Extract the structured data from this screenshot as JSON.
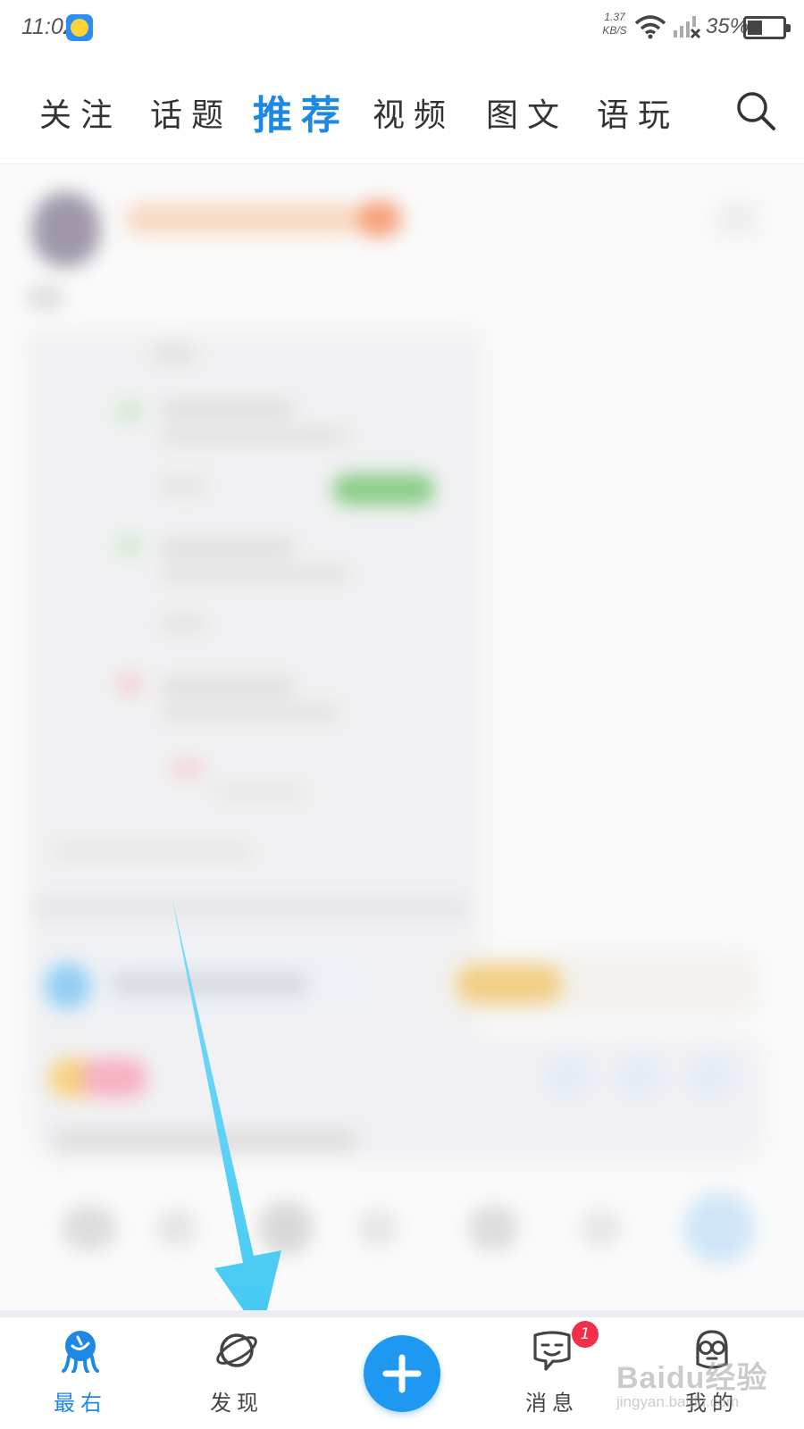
{
  "status_bar": {
    "time": "11:02",
    "net_speed_value": "1.37",
    "net_speed_unit": "KB/S",
    "battery_percent": "35%"
  },
  "top_tabs": [
    {
      "label": "关注",
      "active": false
    },
    {
      "label": "话题",
      "active": false
    },
    {
      "label": "推荐",
      "active": true
    },
    {
      "label": "视频",
      "active": false
    },
    {
      "label": "图文",
      "active": false
    },
    {
      "label": "语玩",
      "active": false
    }
  ],
  "icons": {
    "search": "search-icon",
    "wifi": "wifi-icon",
    "signal": "no-signal-icon",
    "battery": "battery-icon"
  },
  "feed": {
    "state": "blurred"
  },
  "bottom_nav": {
    "items": [
      {
        "label": "最右",
        "icon": "home-mascot-icon",
        "active": true
      },
      {
        "label": "发现",
        "icon": "planet-icon",
        "active": false
      },
      {
        "label": "",
        "icon": "plus-icon",
        "active": false
      },
      {
        "label": "消息",
        "icon": "chat-face-icon",
        "active": false,
        "badge": "1"
      },
      {
        "label": "我的",
        "icon": "profile-glasses-icon",
        "active": false
      }
    ]
  },
  "watermark": {
    "main": "Baidu经验",
    "sub": "jingyan.baidu.com"
  },
  "colors": {
    "accent": "#1e88e5",
    "arrow": "#4fd0f5",
    "badge": "#f0304a"
  }
}
